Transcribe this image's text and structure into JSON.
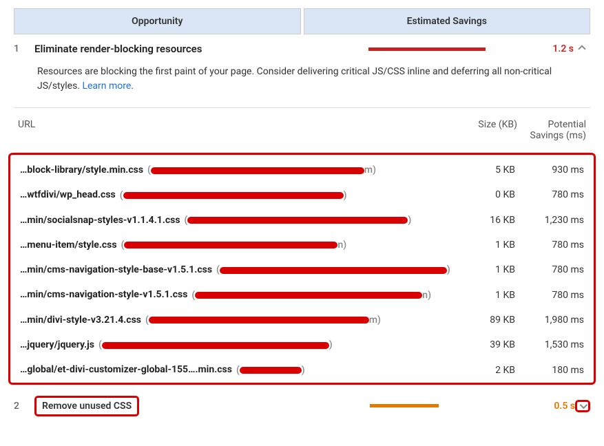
{
  "header": {
    "opportunity": "Opportunity",
    "savings": "Estimated Savings"
  },
  "opportunities": [
    {
      "num": "1",
      "title": "Eliminate render-blocking resources",
      "time": "1.2 s",
      "desc_prefix": "Resources are blocking the first paint of your page. Consider delivering critical JS/CSS inline and deferring all non-critical JS/styles. ",
      "learn_more": "Learn more",
      "desc_suffix": "."
    },
    {
      "num": "2",
      "title": "Remove unused CSS",
      "time": "0.5 s"
    }
  ],
  "table_header": {
    "url": "URL",
    "size": "Size (KB)",
    "savings": "Potential Savings (ms)"
  },
  "resources": [
    {
      "path": "…block-library/style.min.css",
      "size": "5 KB",
      "savings": "930 ms",
      "redact_w": 310,
      "after": "m)"
    },
    {
      "path": "…wtfdivi/wp_head.css",
      "size": "0 KB",
      "savings": "780 ms",
      "redact_w": 320,
      "after": ")"
    },
    {
      "path": "…min/socialsnap-styles-v1.1.4.1.css",
      "size": "16 KB",
      "savings": "1,230 ms",
      "redact_w": 320,
      "after": ")"
    },
    {
      "path": "…menu-item/style.css",
      "size": "1 KB",
      "savings": "780 ms",
      "redact_w": 310,
      "after": "n)"
    },
    {
      "path": "…min/cms-navigation-style-base-v1.5.1.css",
      "size": "1 KB",
      "savings": "780 ms",
      "redact_w": 330,
      "after": ")"
    },
    {
      "path": "…min/cms-navigation-style-v1.5.1.css",
      "size": "1 KB",
      "savings": "780 ms",
      "redact_w": 330,
      "after": "n)"
    },
    {
      "path": "…min/divi-style-v3.21.4.css",
      "size": "89 KB",
      "savings": "1,980 ms",
      "redact_w": 320,
      "after": "m)"
    },
    {
      "path": "…jquery/jquery.js",
      "size": "39 KB",
      "savings": "1,530 ms",
      "redact_w": 330,
      "after": ")"
    },
    {
      "path": "…global/et-divi-customizer-global-155….min.css",
      "size": "2 KB",
      "savings": "180 ms",
      "redact_w": 90,
      "after": ")"
    }
  ]
}
